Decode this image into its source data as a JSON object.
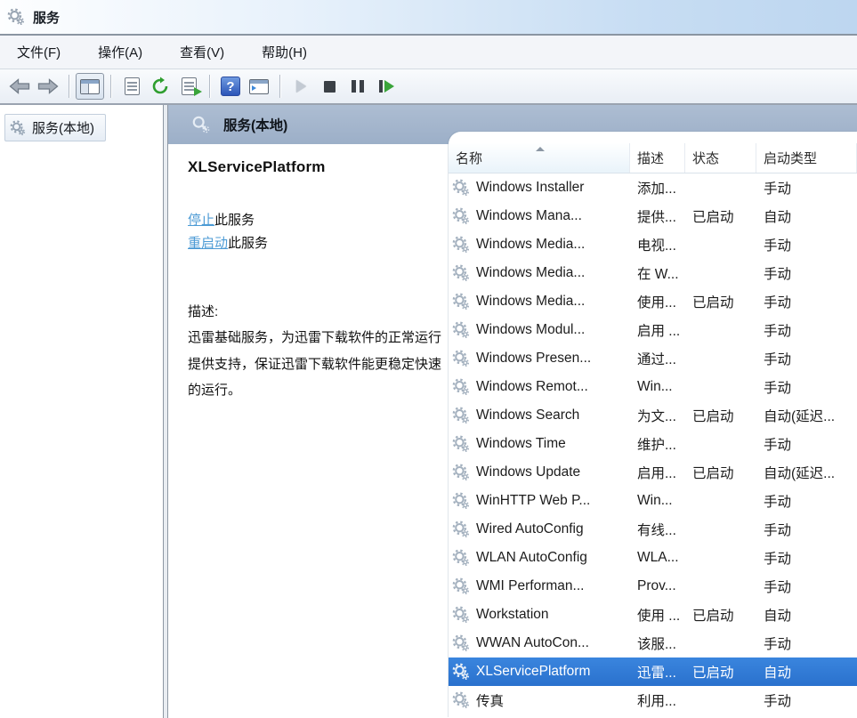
{
  "window": {
    "title": "服务",
    "icon": "services-gear-icon"
  },
  "menu": {
    "items": [
      "文件(F)",
      "操作(A)",
      "查看(V)",
      "帮助(H)"
    ]
  },
  "toolbar": {
    "icons": [
      "back-icon",
      "forward-icon",
      "show-console-tree-icon",
      "properties-icon",
      "refresh-icon",
      "export-list-icon",
      "help-icon",
      "extended-view-icon",
      "start-service-icon",
      "stop-service-icon",
      "pause-service-icon",
      "restart-service-icon"
    ]
  },
  "sidebar": {
    "root_label": "服务(本地)"
  },
  "main": {
    "banner_title": "服务(本地)",
    "service": {
      "name": "XLServicePlatform",
      "stop": {
        "link": "停止",
        "suffix": "此服务"
      },
      "restart": {
        "link": "重启动",
        "suffix": "此服务"
      },
      "desc_label": "描述:",
      "description": "迅雷基础服务，为迅雷下载软件的正常运行提供支持，保证迅雷下载软件能更稳定快速的运行。"
    },
    "table": {
      "columns": [
        "名称",
        "描述",
        "状态",
        "启动类型"
      ],
      "rows": [
        {
          "name": "Windows Installer",
          "desc": "添加...",
          "status": "",
          "type": "手动",
          "selected": false
        },
        {
          "name": "Windows Mana...",
          "desc": "提供...",
          "status": "已启动",
          "type": "自动",
          "selected": false
        },
        {
          "name": "Windows Media...",
          "desc": "电视...",
          "status": "",
          "type": "手动",
          "selected": false
        },
        {
          "name": "Windows Media...",
          "desc": "在 W...",
          "status": "",
          "type": "手动",
          "selected": false
        },
        {
          "name": "Windows Media...",
          "desc": "使用...",
          "status": "已启动",
          "type": "手动",
          "selected": false
        },
        {
          "name": "Windows Modul...",
          "desc": "启用 ...",
          "status": "",
          "type": "手动",
          "selected": false
        },
        {
          "name": "Windows Presen...",
          "desc": "通过...",
          "status": "",
          "type": "手动",
          "selected": false
        },
        {
          "name": "Windows Remot...",
          "desc": "Win...",
          "status": "",
          "type": "手动",
          "selected": false
        },
        {
          "name": "Windows Search",
          "desc": "为文...",
          "status": "已启动",
          "type": "自动(延迟...",
          "selected": false
        },
        {
          "name": "Windows Time",
          "desc": "维护...",
          "status": "",
          "type": "手动",
          "selected": false
        },
        {
          "name": "Windows Update",
          "desc": "启用...",
          "status": "已启动",
          "type": "自动(延迟...",
          "selected": false
        },
        {
          "name": "WinHTTP Web P...",
          "desc": "Win...",
          "status": "",
          "type": "手动",
          "selected": false
        },
        {
          "name": "Wired AutoConfig",
          "desc": "有线...",
          "status": "",
          "type": "手动",
          "selected": false
        },
        {
          "name": "WLAN AutoConfig",
          "desc": "WLA...",
          "status": "",
          "type": "手动",
          "selected": false
        },
        {
          "name": "WMI Performan...",
          "desc": "Prov...",
          "status": "",
          "type": "手动",
          "selected": false
        },
        {
          "name": "Workstation",
          "desc": "使用 ...",
          "status": "已启动",
          "type": "自动",
          "selected": false
        },
        {
          "name": "WWAN AutoCon...",
          "desc": "该服...",
          "status": "",
          "type": "手动",
          "selected": false
        },
        {
          "name": "XLServicePlatform",
          "desc": "迅雷...",
          "status": "已启动",
          "type": "自动",
          "selected": true
        },
        {
          "name": "传真",
          "desc": "利用...",
          "status": "",
          "type": "手动",
          "selected": false
        }
      ]
    }
  },
  "colors": {
    "selection_blue": "#2d7ad7",
    "link_blue": "#4d9bd5",
    "banner_steel_blue": "#a2b3ca",
    "titlebar_blue": "#c7ddf3"
  }
}
